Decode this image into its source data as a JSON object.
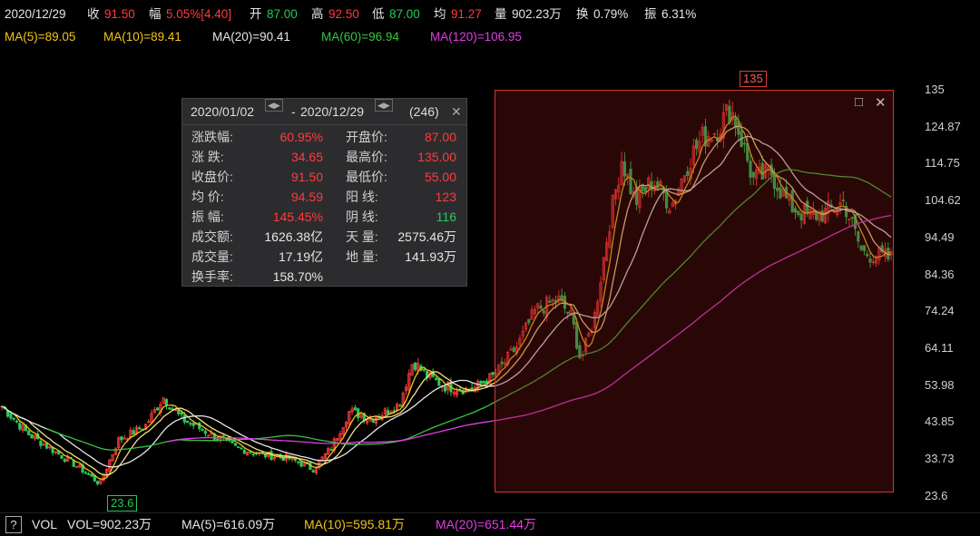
{
  "header": {
    "date": "2020/12/29",
    "close_label": "收",
    "close": "91.50",
    "change_label": "幅",
    "change": "5.05%[4.40]",
    "open_label": "开",
    "open": "87.00",
    "high_label": "高",
    "high": "92.50",
    "low_label": "低",
    "low": "87.00",
    "avg_label": "均",
    "avg": "91.27",
    "volume_label": "量",
    "volume": "902.23万",
    "turnover_label": "换",
    "turnover": "0.79%",
    "amplitude_label": "振",
    "amplitude": "6.31%"
  },
  "ma": {
    "ma5": "MA(5)=89.05",
    "ma10": "MA(10)=89.41",
    "ma20": "MA(20)=90.41",
    "ma60": "MA(60)=96.94",
    "ma120": "MA(120)=106.95"
  },
  "y_axis": [
    "135",
    "124.87",
    "114.75",
    "104.62",
    "94.49",
    "84.36",
    "74.24",
    "64.11",
    "53.98",
    "43.85",
    "33.73",
    "23.6"
  ],
  "flags": {
    "high": "135",
    "low": "23.6"
  },
  "stats": {
    "start_date": "2020/01/02",
    "end_date": "2020/12/29",
    "count": "(246)",
    "left_rows": [
      {
        "label": "涨跌幅:",
        "value": "60.95%",
        "color": "#ff3b3b"
      },
      {
        "label": "涨    跌:",
        "value": "34.65",
        "color": "#ff3b3b"
      },
      {
        "label": "收盘价:",
        "value": "91.50",
        "color": "#ff3b3b"
      },
      {
        "label": "均    价:",
        "value": "94.59",
        "color": "#ff3b3b"
      },
      {
        "label": "振    幅:",
        "value": "145.45%",
        "color": "#ff3b3b"
      },
      {
        "label": "成交额:",
        "value": "1626.38亿",
        "color": "#e6e6e6"
      },
      {
        "label": "成交量:",
        "value": "17.19亿",
        "color": "#e6e6e6"
      },
      {
        "label": "换手率:",
        "value": "158.70%",
        "color": "#e6e6e6"
      }
    ],
    "right_rows": [
      {
        "label": "开盘价:",
        "value": "87.00",
        "color": "#ff3b3b"
      },
      {
        "label": "最高价:",
        "value": "135.00",
        "color": "#ff3b3b"
      },
      {
        "label": "最低价:",
        "value": "55.00",
        "color": "#ff3b3b"
      },
      {
        "label": "阳    线:",
        "value": "123",
        "color": "#ff3b3b"
      },
      {
        "label": "阴    线:",
        "value": "116",
        "color": "#27c95a"
      },
      {
        "label": "天    量:",
        "value": "2575.46万",
        "color": "#e6e6e6"
      },
      {
        "label": "地    量:",
        "value": "141.93万",
        "color": "#e6e6e6"
      }
    ]
  },
  "volume": {
    "help": "?",
    "label": "VOL",
    "vol": "VOL=902.23万",
    "ma5": "MA(5)=616.09万",
    "ma10": "MA(10)=595.81万",
    "ma20": "MA(20)=651.44万"
  },
  "colors": {
    "up": "#ff3b3b",
    "down": "#27c95a",
    "ma5": "#f0c419",
    "ma20": "#e6e6e6",
    "ma60": "#39c240",
    "ma120": "#e23ee6"
  }
}
